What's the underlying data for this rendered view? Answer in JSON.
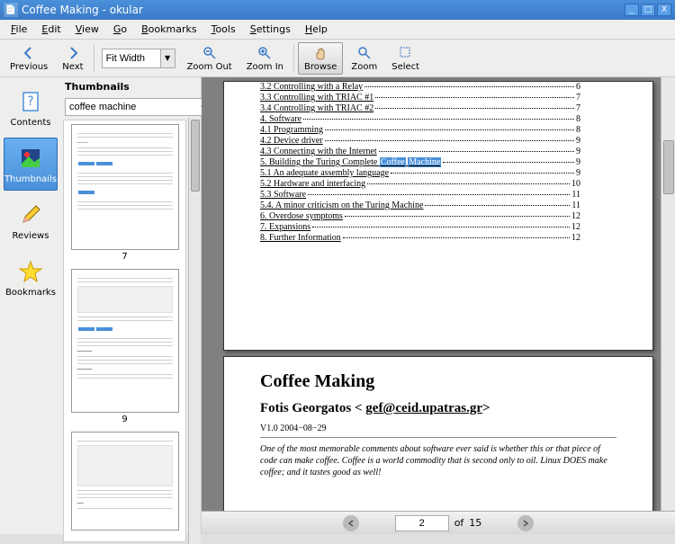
{
  "window": {
    "title": "Coffee Making - okular",
    "min": "_",
    "max": "□",
    "close": "X"
  },
  "menu": {
    "file": "File",
    "edit": "Edit",
    "view": "View",
    "go": "Go",
    "bookmarks": "Bookmarks",
    "tools": "Tools",
    "settings": "Settings",
    "help": "Help"
  },
  "toolbar": {
    "previous": "Previous",
    "next": "Next",
    "zoom_value": "Fit Width",
    "zoom_out": "Zoom Out",
    "zoom_in": "Zoom In",
    "browse": "Browse",
    "zoom": "Zoom",
    "select": "Select"
  },
  "sidebar": {
    "tabs": {
      "contents": "Contents",
      "thumbnails": "Thumbnails",
      "reviews": "Reviews",
      "bookmarks": "Bookmarks"
    },
    "panel_title": "Thumbnails",
    "search_value": "coffee machine",
    "thumb_labels": {
      "t1": "7",
      "t2": "9"
    }
  },
  "doc": {
    "toc": [
      {
        "title": "3.2 Controlling with a Relay",
        "page": "6"
      },
      {
        "title": "3.3 Controlling with TRIAC #1",
        "page": "7"
      },
      {
        "title": "3.4 Controlling with TRIAC #2",
        "page": "7"
      },
      {
        "title": "4. Software",
        "page": "8"
      },
      {
        "title": "4.1 Programming",
        "page": "8"
      },
      {
        "title": "4.2 Device driver",
        "page": "9"
      },
      {
        "title": "4.3 Connecting with the Internet",
        "page": "9"
      },
      {
        "title_pre": "5. Building the Turing Complete ",
        "hl1": "Coffee",
        "mid": " ",
        "hl2": "Machine",
        "page": "9"
      },
      {
        "title": "5.1 An adequate assembly language",
        "page": "9"
      },
      {
        "title": "5.2 Hardware and interfacing",
        "page": "10"
      },
      {
        "title": "5.3 Software",
        "page": "11"
      },
      {
        "title": "5.4. A minor criticism on the Turing Machine",
        "page": "11"
      },
      {
        "title": "6. Overdose symptoms",
        "page": "12"
      },
      {
        "title": "7. Expansions",
        "page": "12"
      },
      {
        "title": "8. Further Information",
        "page": "12"
      }
    ],
    "title": "Coffee Making",
    "author_pre": "Fotis Georgatos < ",
    "author_email": "gef@ceid.upatras.gr",
    "author_post": ">",
    "version": "V1.0 2004−08−29",
    "intro": "One of the most memorable comments about software ever said is whether this or that piece of code can make coffee. Coffee is a world commodity that is second only to oil. Linux DOES make coffee; and it tastes good as well!"
  },
  "pagebar": {
    "current": "2",
    "of": "of",
    "total": "15"
  }
}
